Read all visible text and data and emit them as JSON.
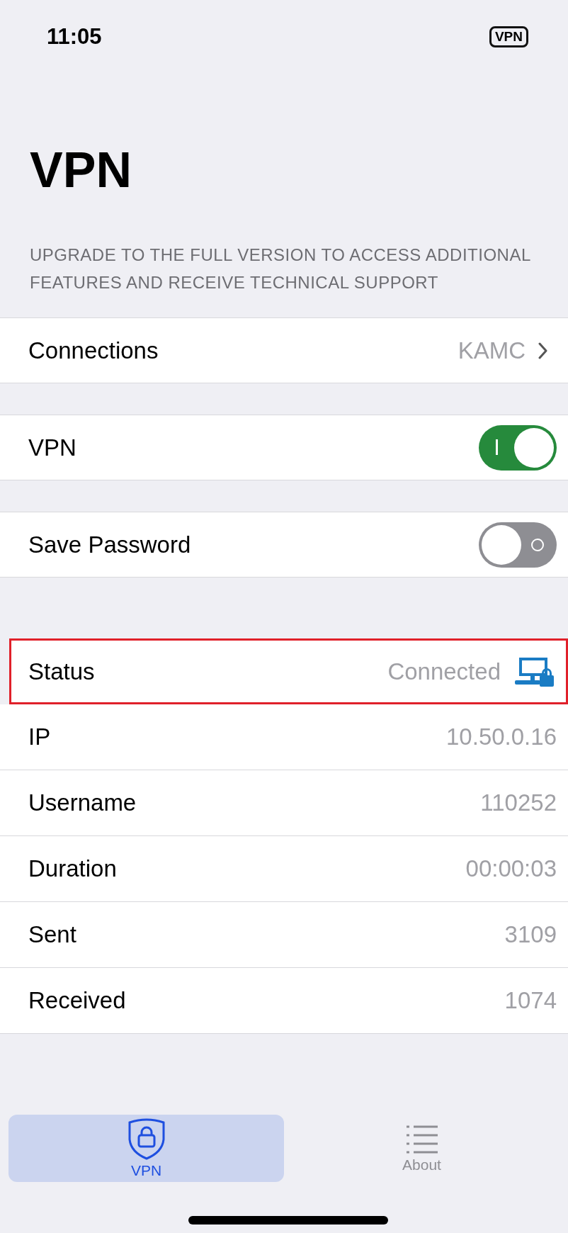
{
  "status_bar": {
    "time": "11:05",
    "vpn_badge": "VPN"
  },
  "title": "VPN",
  "notice": "UPGRADE TO THE FULL VERSION TO ACCESS ADDITIONAL FEATURES AND RECEIVE TECHNICAL SUPPORT",
  "connections": {
    "label": "Connections",
    "value": "KAMC"
  },
  "toggles": [
    {
      "label": "VPN",
      "on": true
    },
    {
      "label": "Save Password",
      "on": false
    }
  ],
  "info": [
    {
      "kind": "status",
      "label": "Status",
      "value": "Connected",
      "highlighted": true
    },
    {
      "kind": "plain",
      "label": "IP",
      "value": "10.50.0.16",
      "highlighted": false
    },
    {
      "kind": "plain",
      "label": "Username",
      "value": "110252",
      "highlighted": false
    },
    {
      "kind": "plain",
      "label": "Duration",
      "value": "00:00:03",
      "highlighted": false
    },
    {
      "kind": "plain",
      "label": "Sent",
      "value": "3109",
      "highlighted": false
    },
    {
      "kind": "plain",
      "label": "Received",
      "value": "1074",
      "highlighted": false
    }
  ],
  "tabs": [
    {
      "label": "VPN",
      "selected": true
    },
    {
      "label": "About",
      "selected": false
    }
  ]
}
